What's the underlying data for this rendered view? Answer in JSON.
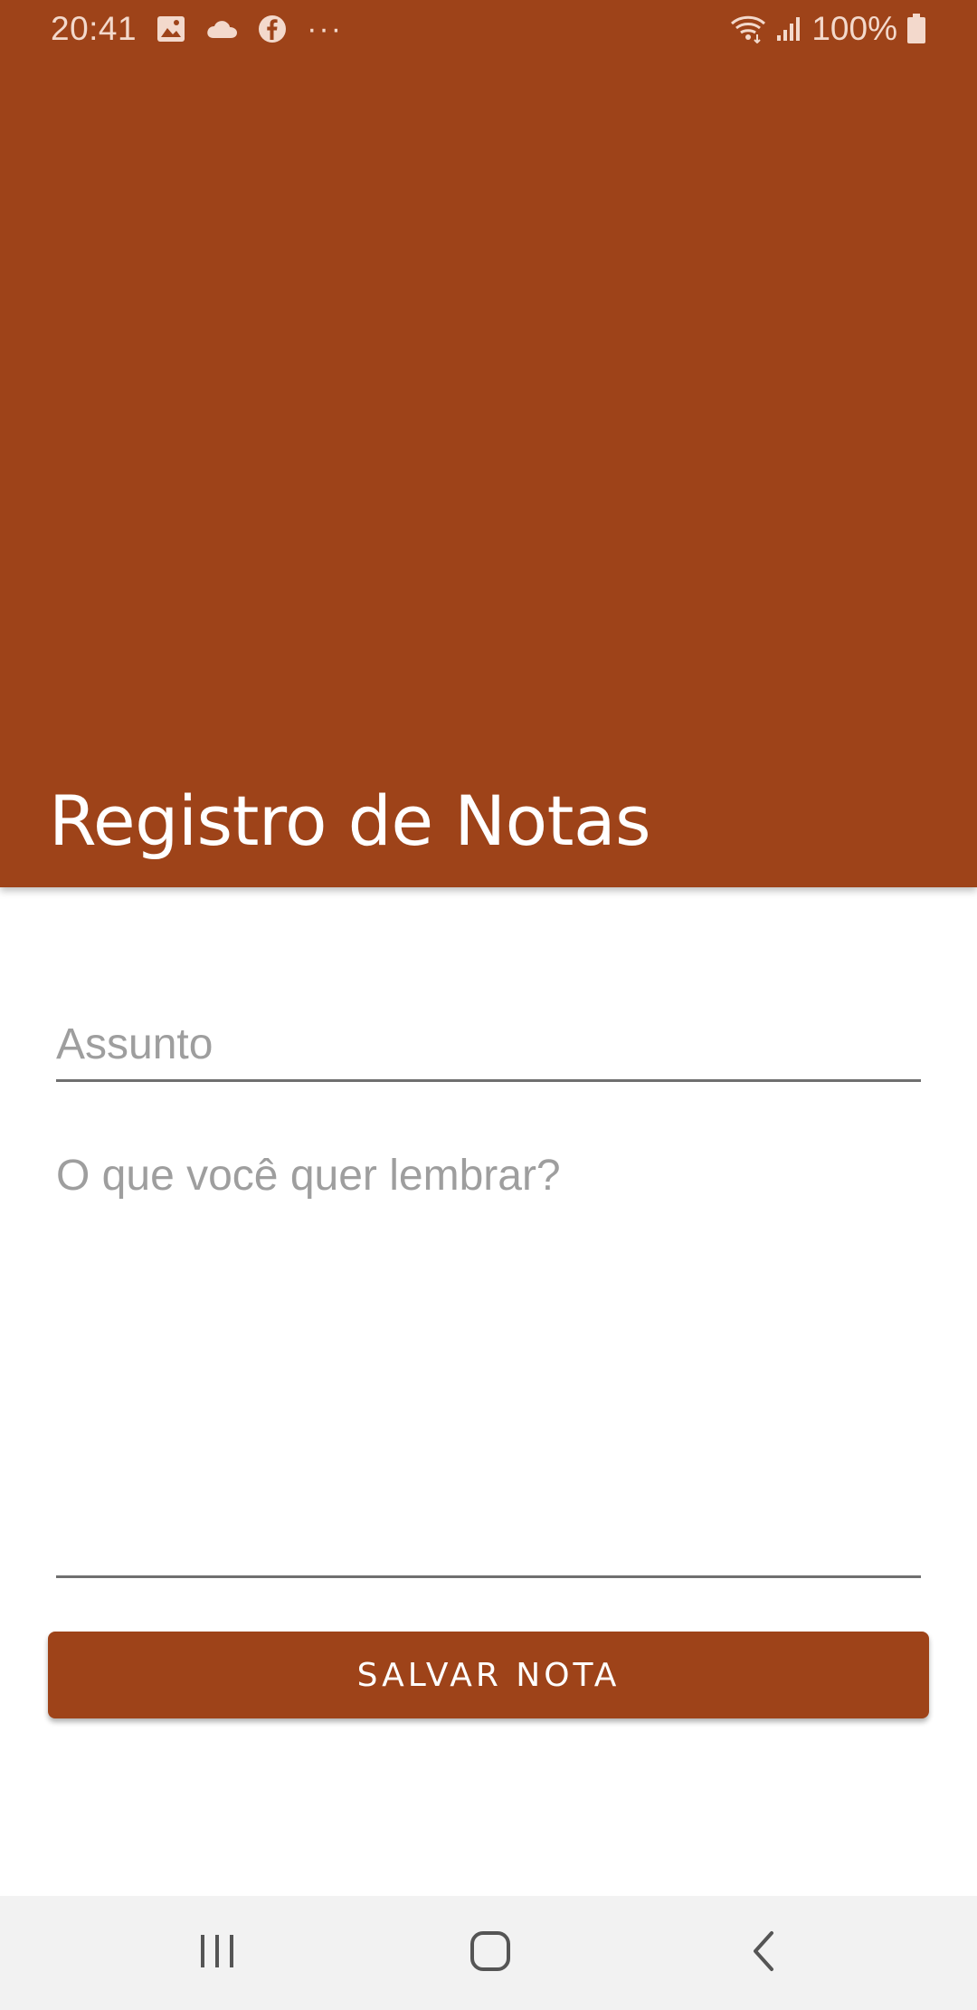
{
  "status_bar": {
    "time": "20:41",
    "battery_percent": "100%",
    "more_indicator": "···",
    "icons": [
      "image-icon",
      "cloud-icon",
      "facebook-icon",
      "wifi-icon",
      "signal-icon",
      "battery-icon"
    ]
  },
  "header": {
    "title": "Registro de Notas",
    "color": "#9e4319"
  },
  "form": {
    "subject_placeholder": "Assunto",
    "subject_value": "",
    "body_placeholder": "O que você quer lembrar?",
    "body_value": "",
    "save_label": "SALVAR NOTA"
  },
  "nav_bar": {
    "icons": [
      "recents-icon",
      "home-icon",
      "back-icon"
    ]
  }
}
